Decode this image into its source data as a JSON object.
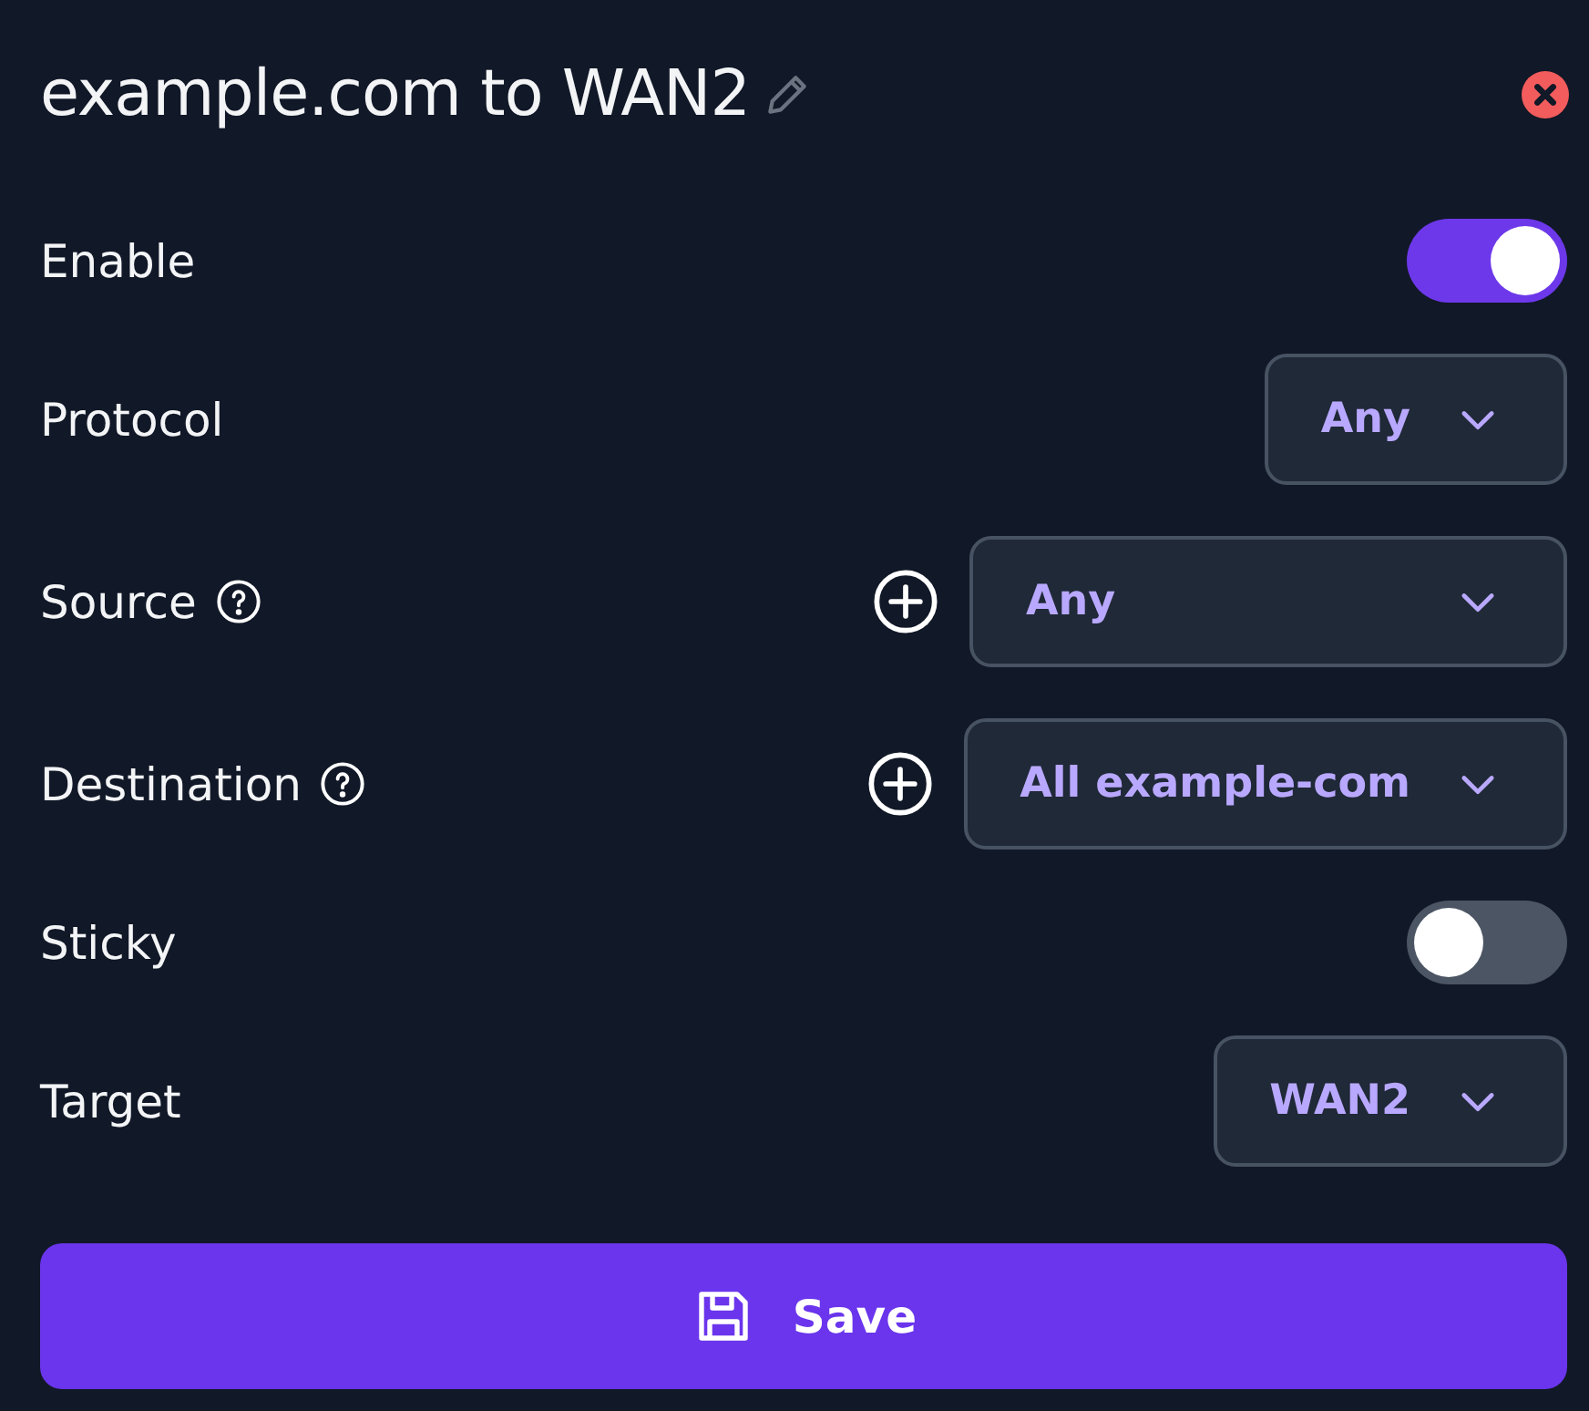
{
  "title": "example.com to WAN2",
  "fields": [
    {
      "kind": "toggle",
      "label": "Enable",
      "help": false,
      "on": true
    },
    {
      "kind": "select",
      "label": "Protocol",
      "help": false,
      "add": false,
      "value": "Any"
    },
    {
      "kind": "select",
      "label": "Source",
      "help": true,
      "add": true,
      "value": "Any"
    },
    {
      "kind": "select",
      "label": "Destination",
      "help": true,
      "add": true,
      "value": "All example-com"
    },
    {
      "kind": "toggle",
      "label": "Sticky",
      "help": false,
      "on": false
    },
    {
      "kind": "select",
      "label": "Target",
      "help": false,
      "add": false,
      "value": "WAN2"
    }
  ],
  "save_button": "Save"
}
